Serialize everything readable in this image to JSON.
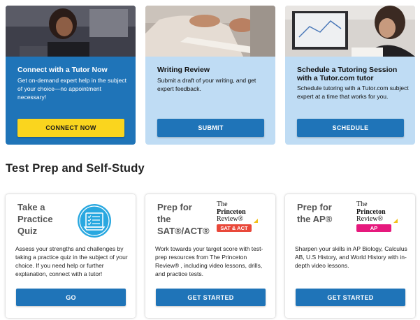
{
  "top_cards": [
    {
      "title": "Connect with a Tutor Now",
      "description": "Get on-demand expert help in the subject of your choice—no appointment necessary!",
      "button": "CONNECT NOW"
    },
    {
      "title": "Writing Review",
      "description": "Submit a draft of your writing, and get expert feedback.",
      "button": "SUBMIT"
    },
    {
      "title": "Schedule a Tutoring Session with a Tutor.com tutor",
      "description": "Schedule tutoring with a Tutor.com subject expert at a time that works for you.",
      "button": "SCHEDULE"
    }
  ],
  "section": {
    "title": "Test Prep and Self-Study"
  },
  "prep_cards": [
    {
      "title_lines": [
        "Take a",
        "Practice",
        "Quiz"
      ],
      "description": "Assess your strengths and challenges by taking a practice quiz in the subject of your choice. If you need help or further explanation, connect with a tutor!",
      "button": "GO",
      "icon": "quiz-icon"
    },
    {
      "title_lines": [
        "Prep for",
        "the",
        "SAT®/ACT®"
      ],
      "description": "Work towards your target score with test-prep resources from The Princeton Review® , including video lessons, drills, and practice tests.",
      "button": "GET STARTED",
      "logo": {
        "line1": "The",
        "line2": "Princeton",
        "line3": "Review®",
        "badge": "SAT & ACT"
      }
    },
    {
      "title_lines": [
        "Prep for",
        "the AP®"
      ],
      "description": "Sharpen your skills in AP Biology, Calculus AB, U.S History, and World History with in-depth video lessons.",
      "button": "GET STARTED",
      "logo": {
        "line1": "The",
        "line2": "Princeton",
        "line3": "Review®",
        "badge": "AP"
      }
    }
  ],
  "colors": {
    "brand_blue": "#1f74b8",
    "light_blue": "#bfdcf4",
    "yellow": "#fad51e",
    "sat_badge": "#e9483a",
    "ap_badge": "#e6197d"
  }
}
